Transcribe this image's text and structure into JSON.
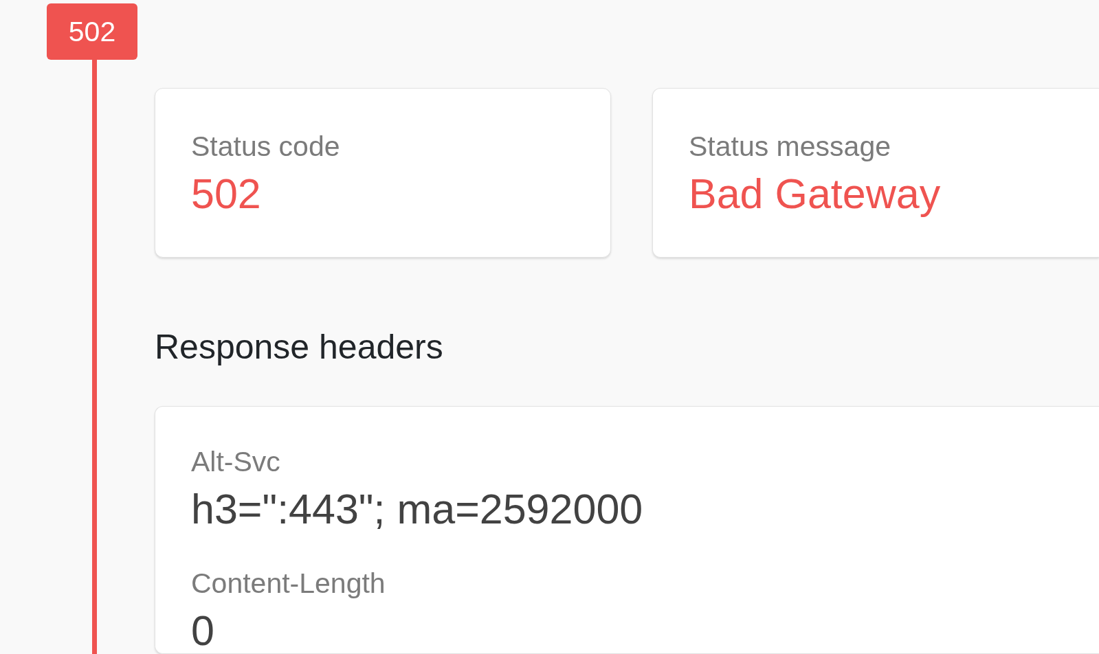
{
  "response": {
    "error": true,
    "badge": "502",
    "status_cards": [
      {
        "label": "Status code",
        "value": "502"
      },
      {
        "label": "Status message",
        "value": "Bad Gateway"
      }
    ],
    "headers_title": "Response headers",
    "headers": [
      {
        "name": "Alt-Svc",
        "value": "h3=\":443\"; ma=2592000"
      },
      {
        "name": "Content-Length",
        "value": "0"
      }
    ]
  }
}
